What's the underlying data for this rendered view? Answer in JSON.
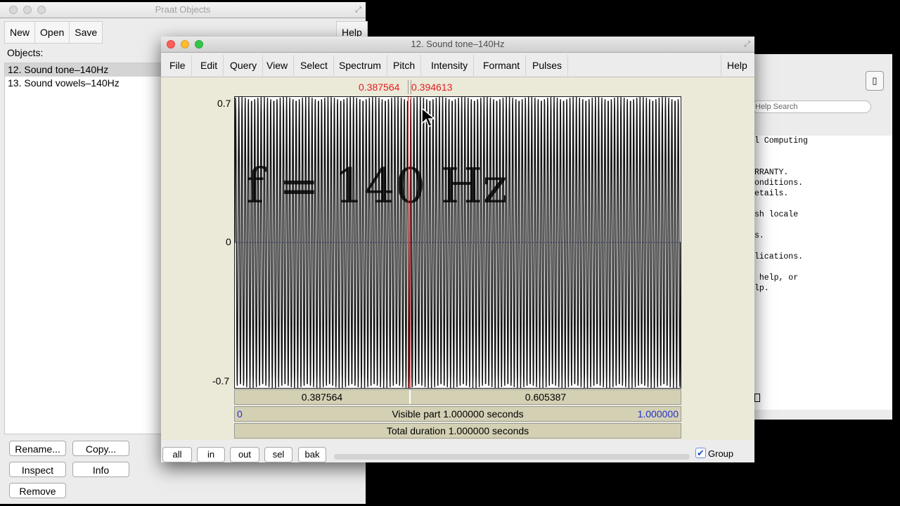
{
  "objects_window": {
    "title": "Praat Objects",
    "toolbar": [
      "New",
      "Open",
      "Save"
    ],
    "help_label": "Help",
    "objects_label": "Objects:",
    "items": [
      "12. Sound tone–140Hz",
      "13. Sound vowels–140Hz"
    ],
    "buttons": {
      "rename": "Rename...",
      "copy": "Copy...",
      "inspect": "Inspect",
      "info": "Info",
      "remove": "Remove"
    }
  },
  "help_window": {
    "search_placeholder": "Help Search",
    "lines": [
      "l Computing",
      "",
      "",
      "RRANTY.",
      "onditions.",
      "etails.",
      "",
      "sh locale",
      "",
      "s.",
      "",
      "lications.",
      "",
      " help, or",
      "lp."
    ]
  },
  "sound_editor": {
    "title": "12. Sound tone–140Hz",
    "menus": [
      "File",
      "Edit",
      "Query",
      "View",
      "Select",
      "Spectrum",
      "Pitch",
      "Intensity",
      "Formant",
      "Pulses"
    ],
    "help_label": "Help",
    "cursor_left": "0.387564",
    "cursor_right": "0.394613",
    "y_max": "0.7",
    "y_zero": "0",
    "y_min": "-0.7",
    "annotation": "f = 140 Hz",
    "bar1_left": "0.387564",
    "bar1_right": "0.605387",
    "visible_start": "0",
    "visible_text": "Visible part 1.000000 seconds",
    "visible_end": "1.000000",
    "total_text": "Total duration 1.000000 seconds",
    "bottom_buttons": [
      "all",
      "in",
      "out",
      "sel",
      "bak"
    ],
    "group_label": "Group",
    "group_checked": true
  },
  "chart_data": {
    "type": "line",
    "title": "",
    "xlabel": "",
    "ylabel": "",
    "xlim": [
      0,
      1
    ],
    "ylim": [
      -0.7,
      0.7
    ],
    "frequency_hz": 140,
    "selection": [
      0.387564,
      0.394613
    ]
  }
}
